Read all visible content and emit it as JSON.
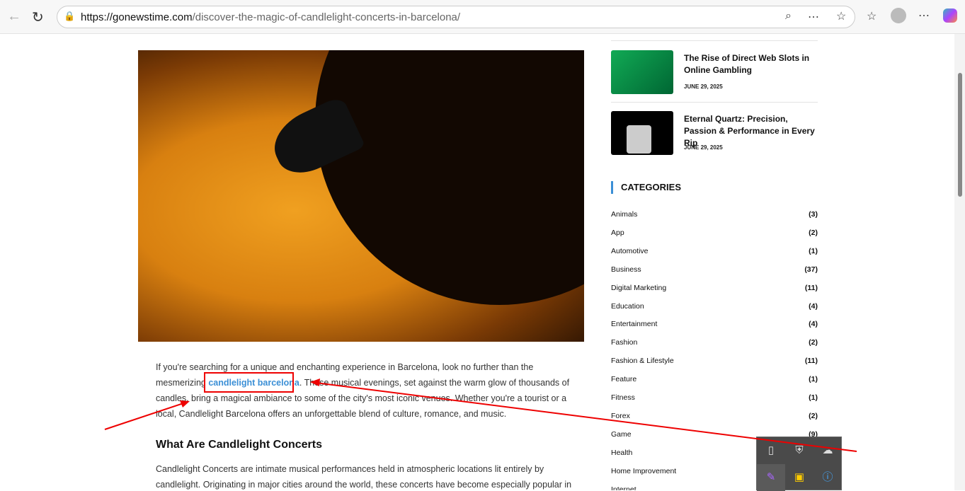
{
  "browser": {
    "url_domain": "https://gonewstime.com",
    "url_path": "/discover-the-magic-of-candlelight-concerts-in-barcelona/"
  },
  "article": {
    "para1_a": "If you're searching for a unique and enchanting experience in Barcelona, look no further than the mesmerizing ",
    "link": "candlelight barcelona",
    "para1_b": ". These musical evenings, set against the warm glow of thousands of candles, bring a magical ambiance to some of the city's most iconic venues. Whether you're a tourist or a local, Candlelight Barcelona offers an unforgettable blend of culture, romance, and music.",
    "heading": "What Are Candlelight Concerts",
    "para2": "Candlelight Concerts are intimate musical performances held in atmospheric locations lit entirely by candlelight. Originating in major cities around the world, these concerts have become especially popular in"
  },
  "sidebar": {
    "posts": [
      {
        "title": "The Rise of Direct Web Slots in Online Gambling",
        "date": "JUNE 29, 2025"
      },
      {
        "title": "Eternal Quartz: Precision, Passion & Performance in Every Rip",
        "date": "JUNE 29, 2025"
      }
    ],
    "categories_title": "CATEGORIES",
    "categories": [
      {
        "name": "Animals",
        "count": "(3)"
      },
      {
        "name": "App",
        "count": "(2)"
      },
      {
        "name": "Automotive",
        "count": "(1)"
      },
      {
        "name": "Business",
        "count": "(37)"
      },
      {
        "name": "Digital Marketing",
        "count": "(11)"
      },
      {
        "name": "Education",
        "count": "(4)"
      },
      {
        "name": "Entertainment",
        "count": "(4)"
      },
      {
        "name": "Fashion",
        "count": "(2)"
      },
      {
        "name": "Fashion & Lifestyle",
        "count": "(11)"
      },
      {
        "name": "Feature",
        "count": "(1)"
      },
      {
        "name": "Fitness",
        "count": "(1)"
      },
      {
        "name": "Forex",
        "count": "(2)"
      },
      {
        "name": "Game",
        "count": "(9)"
      },
      {
        "name": "Health",
        "count": ""
      },
      {
        "name": "Home Improvement",
        "count": ""
      },
      {
        "name": "Internet",
        "count": ""
      }
    ]
  }
}
